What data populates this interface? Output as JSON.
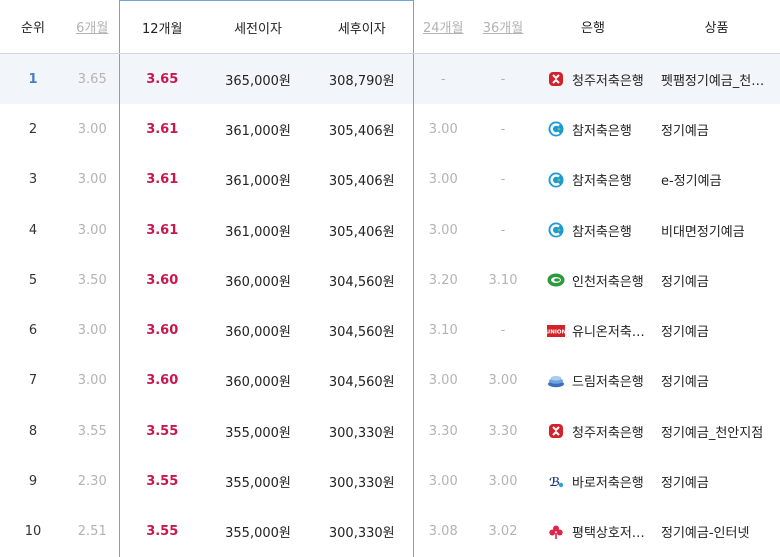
{
  "headers": {
    "rank": "순위",
    "m6": "6개월",
    "m12": "12개월",
    "pretax": "세전이자",
    "posttax": "세후이자",
    "m24": "24개월",
    "m36": "36개월",
    "bank": "은행",
    "product": "상품"
  },
  "rows": [
    {
      "rank": "1",
      "m6": "3.65",
      "m12": "3.65",
      "pretax": "365,000원",
      "posttax": "308,790원",
      "m24": "-",
      "m36": "-",
      "bank": "청주저축은행",
      "bank_logo": "cheongju-logo-icon",
      "product": "펫팸정기예금_천…"
    },
    {
      "rank": "2",
      "m6": "3.00",
      "m12": "3.61",
      "pretax": "361,000원",
      "posttax": "305,406원",
      "m24": "3.00",
      "m36": "-",
      "bank": "참저축은행",
      "bank_logo": "cham-logo-icon",
      "product": "정기예금"
    },
    {
      "rank": "3",
      "m6": "3.00",
      "m12": "3.61",
      "pretax": "361,000원",
      "posttax": "305,406원",
      "m24": "3.00",
      "m36": "-",
      "bank": "참저축은행",
      "bank_logo": "cham-logo-icon",
      "product": "e-정기예금"
    },
    {
      "rank": "4",
      "m6": "3.00",
      "m12": "3.61",
      "pretax": "361,000원",
      "posttax": "305,406원",
      "m24": "3.00",
      "m36": "-",
      "bank": "참저축은행",
      "bank_logo": "cham-logo-icon",
      "product": "비대면정기예금"
    },
    {
      "rank": "5",
      "m6": "3.50",
      "m12": "3.60",
      "pretax": "360,000원",
      "posttax": "304,560원",
      "m24": "3.20",
      "m36": "3.10",
      "bank": "인천저축은행",
      "bank_logo": "incheon-logo-icon",
      "product": "정기예금"
    },
    {
      "rank": "6",
      "m6": "3.00",
      "m12": "3.60",
      "pretax": "360,000원",
      "posttax": "304,560원",
      "m24": "3.10",
      "m36": "-",
      "bank": "유니온저축…",
      "bank_logo": "union-logo-icon",
      "product": "정기예금"
    },
    {
      "rank": "7",
      "m6": "3.00",
      "m12": "3.60",
      "pretax": "360,000원",
      "posttax": "304,560원",
      "m24": "3.00",
      "m36": "3.00",
      "bank": "드림저축은행",
      "bank_logo": "dream-logo-icon",
      "product": "정기예금"
    },
    {
      "rank": "8",
      "m6": "3.55",
      "m12": "3.55",
      "pretax": "355,000원",
      "posttax": "300,330원",
      "m24": "3.30",
      "m36": "3.30",
      "bank": "청주저축은행",
      "bank_logo": "cheongju-logo-icon",
      "product": "정기예금_천안지점"
    },
    {
      "rank": "9",
      "m6": "2.30",
      "m12": "3.55",
      "pretax": "355,000원",
      "posttax": "300,330원",
      "m24": "3.00",
      "m36": "3.00",
      "bank": "바로저축은행",
      "bank_logo": "baro-logo-icon",
      "product": "정기예금"
    },
    {
      "rank": "10",
      "m6": "2.51",
      "m12": "3.55",
      "pretax": "355,000원",
      "posttax": "300,330원",
      "m24": "3.08",
      "m36": "3.02",
      "bank": "평택상호저…",
      "bank_logo": "pyeongtaek-logo-icon",
      "product": "정기예금-인터넷"
    }
  ],
  "logo_text": {
    "union": "UNION"
  },
  "colors": {
    "rate": "#c8174d",
    "highlight_border": "#6ea6db",
    "muted": "#b3b3b3",
    "row_highlight": "#f2f6fb",
    "rank_highlight": "#4a7fc1"
  }
}
